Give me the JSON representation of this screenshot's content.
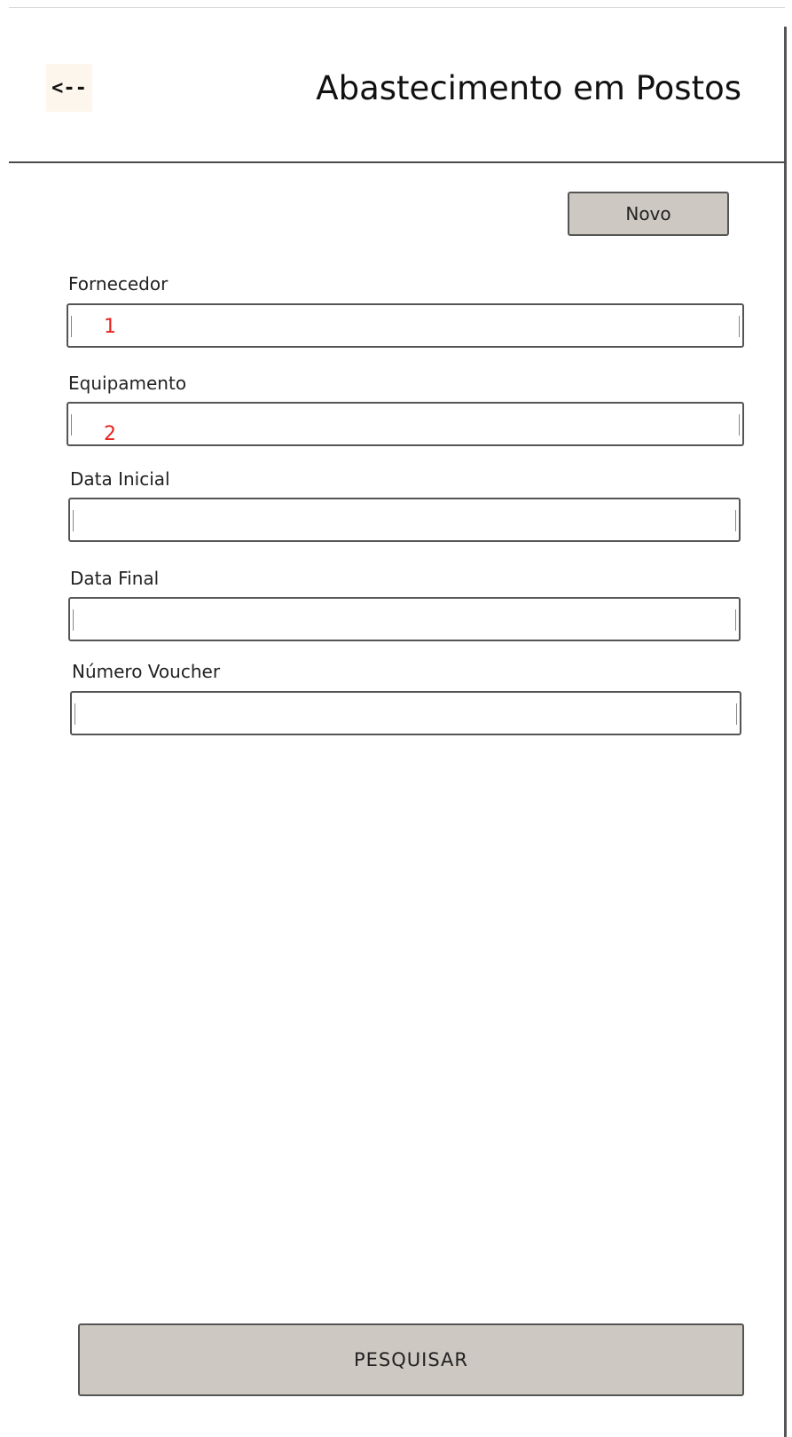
{
  "header": {
    "back_label": "<--",
    "title": "Abastecimento em Postos"
  },
  "toolbar": {
    "new_label": "Novo"
  },
  "form": {
    "fields": [
      {
        "label": "Fornecedor",
        "annotation": "1",
        "value": ""
      },
      {
        "label": "Equipamento",
        "annotation": "2",
        "value": ""
      },
      {
        "label": "Data Inicial",
        "value": ""
      },
      {
        "label": "Data Final",
        "value": ""
      },
      {
        "label": "Número Voucher",
        "value": ""
      }
    ]
  },
  "footer": {
    "search_label": "PESQUISAR"
  },
  "colors": {
    "button_fill": "#cdc8c2",
    "annotation_red": "#e8231f",
    "back_button_fill": "#fdf6ec"
  }
}
